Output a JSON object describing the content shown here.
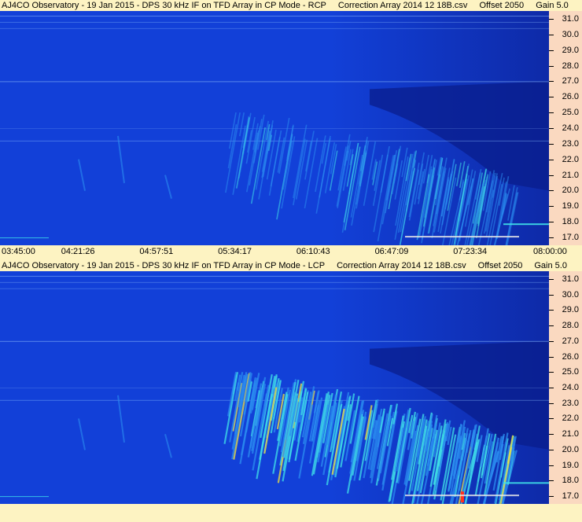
{
  "chart_data": [
    {
      "type": "heatmap",
      "title_parts": [
        "AJ4CO Observatory - 19 Jan 2015 - DPS 30 kHz IF on TFD Array in CP Mode - RCP",
        "Correction Array 2014 12 18B.csv",
        "Offset 2050",
        "Gain 5.0"
      ],
      "yticks": [
        "31.0",
        "30.0",
        "29.0",
        "28.0",
        "27.0",
        "26.0",
        "25.0",
        "24.0",
        "23.0",
        "22.0",
        "21.0",
        "20.0",
        "19.0",
        "18.0",
        "17.0"
      ],
      "xticks": [
        "03:45:00",
        "04:21:26",
        "04:57:51",
        "05:34:17",
        "06:10:43",
        "06:47:09",
        "07:23:34",
        "08:00:00"
      ],
      "ylim": [
        16.5,
        31.5
      ],
      "colors": {
        "background": "#1240d8",
        "deep": "#0a1e8c",
        "mid": "#2a8cf0",
        "bright": "#3fe0e8",
        "hot": "#f0e040",
        "peak": "#ff3020"
      }
    },
    {
      "type": "heatmap",
      "title_parts": [
        "AJ4CO Observatory - 19 Jan 2015 - DPS 30 kHz IF on TFD Array in CP Mode - LCP",
        "Correction Array 2014 12 18B.csv",
        "Offset 2050",
        "Gain 5.0"
      ],
      "yticks": [
        "31.0",
        "30.0",
        "29.0",
        "28.0",
        "27.0",
        "26.0",
        "25.0",
        "24.0",
        "23.0",
        "22.0",
        "21.0",
        "20.0",
        "19.0",
        "18.0",
        "17.0"
      ],
      "xticks": [],
      "ylim": [
        16.5,
        31.5
      ],
      "colors": {
        "background": "#1240d8",
        "deep": "#0a1e8c",
        "mid": "#2a8cf0",
        "bright": "#3fe0e8",
        "hot": "#f0e040",
        "peak": "#ff3020"
      }
    }
  ]
}
